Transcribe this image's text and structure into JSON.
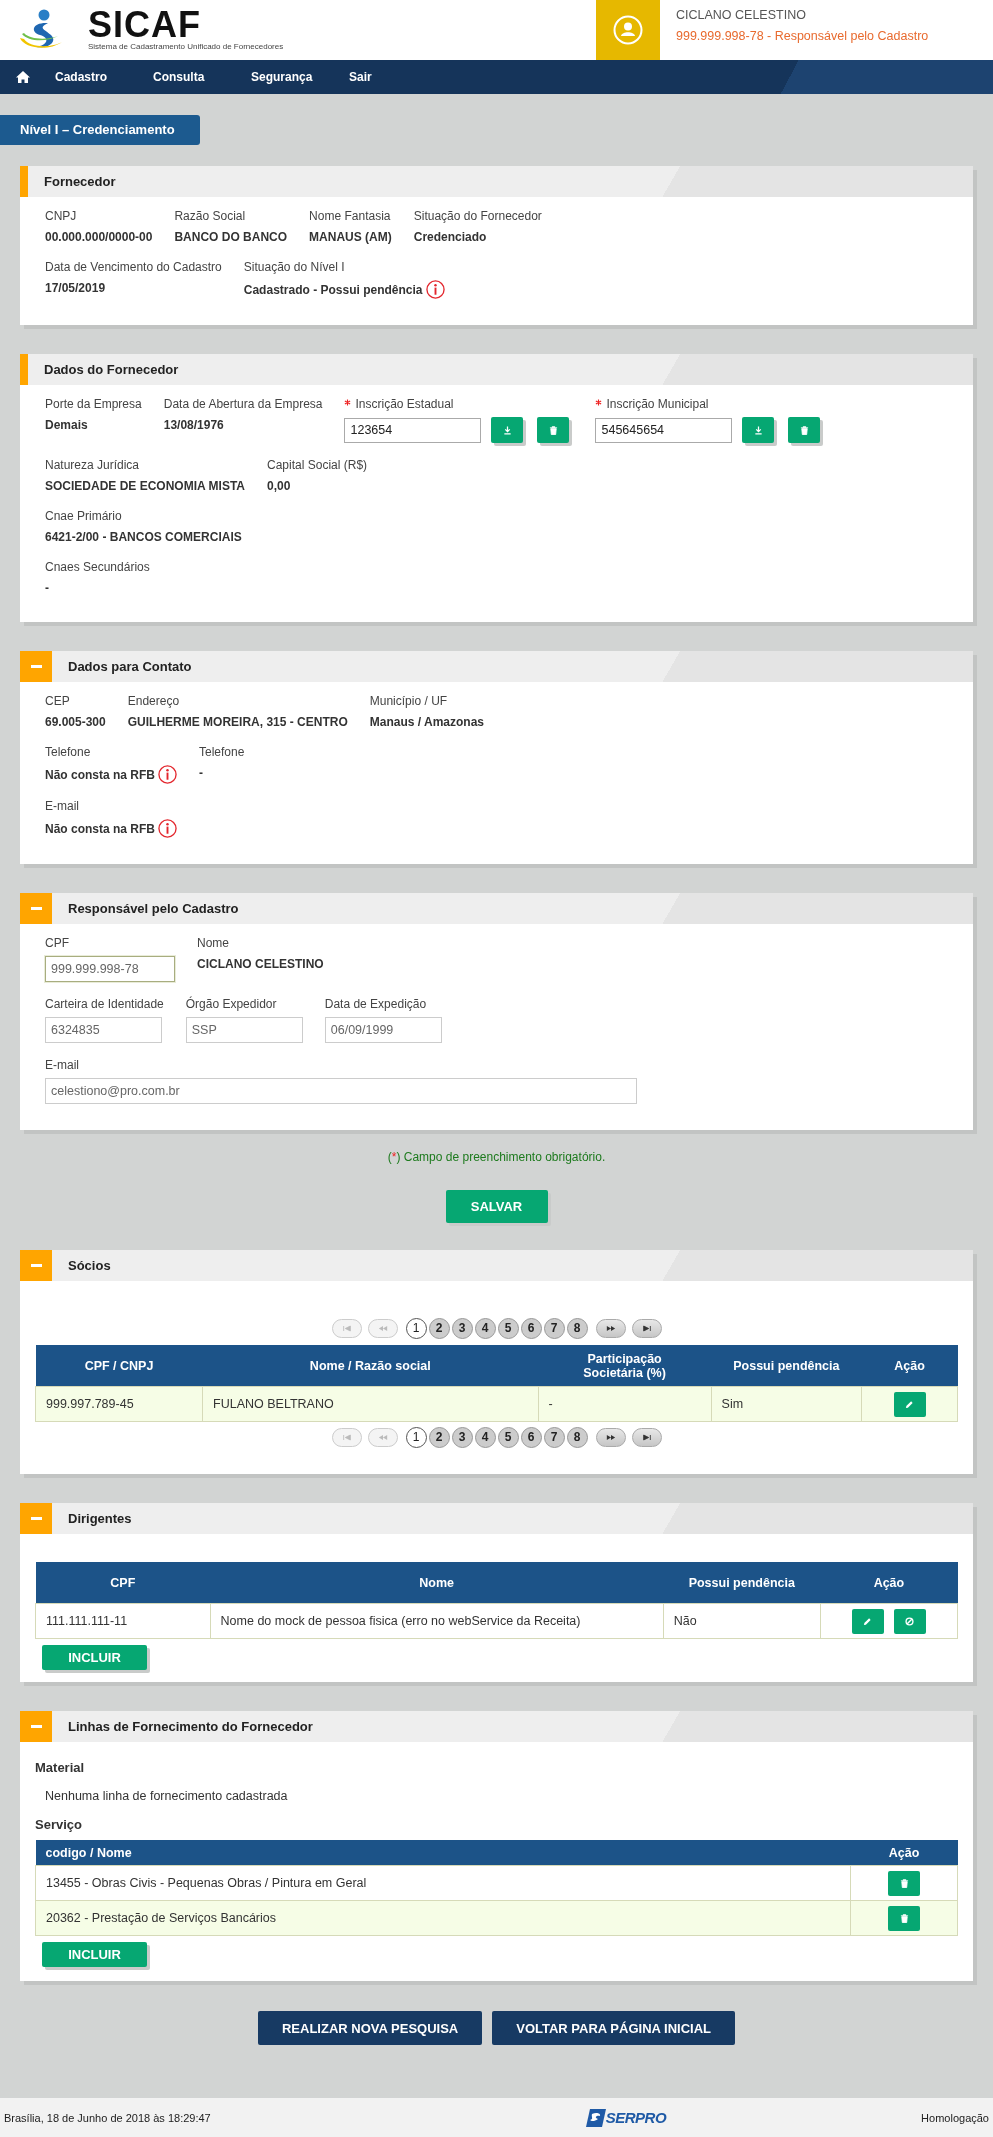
{
  "header": {
    "logo": {
      "name": "SICAF",
      "subtitle": "Sistema de Cadastramento Unificado de Fornecedores"
    },
    "user": {
      "name": "CICLANO CELESTINO",
      "details": "999.999.998-78 - Responsável pelo Cadastro"
    }
  },
  "nav": {
    "items": [
      "Cadastro",
      "Consulta",
      "Segurança",
      "Sair"
    ]
  },
  "page_badge": "Nível I – Credenciamento",
  "sections_top": [
    {
      "title": "Fornecedor",
      "collapsible": false,
      "rows": [
        [
          {
            "kind": "text",
            "label": "CNPJ",
            "value": "00.000.000/0000-00",
            "alert": false
          },
          {
            "kind": "text",
            "label": "Razão Social",
            "value": "BANCO DO BANCO",
            "alert": false
          },
          {
            "kind": "text",
            "label": "Nome Fantasia",
            "value": "MANAUS (AM)",
            "alert": false
          },
          {
            "kind": "text",
            "label": "Situação do Fornecedor",
            "value": "Credenciado",
            "alert": false
          }
        ],
        [
          {
            "kind": "text",
            "label": "Data de Vencimento do Cadastro",
            "value": "17/05/2019",
            "alert": false
          },
          {
            "kind": "text",
            "label": "Situação do Nível I",
            "value": "Cadastrado - Possui pendência",
            "alert": true
          }
        ]
      ]
    },
    {
      "title": "Dados do Fornecedor",
      "collapsible": false,
      "rows": [
        [
          {
            "kind": "text",
            "label": "Porte da Empresa",
            "value": "Demais",
            "alert": false
          },
          {
            "kind": "text",
            "label": "Data de Abertura da Empresa",
            "value": "13/08/1976",
            "alert": false
          },
          {
            "kind": "input_actions",
            "label": "Inscrição Estadual",
            "value": "123654",
            "required": true
          },
          {
            "kind": "input_actions",
            "label": "Inscrição Municipal",
            "value": "545645654",
            "required": true
          }
        ],
        [
          {
            "kind": "text",
            "label": "Natureza Jurídica",
            "value": "SOCIEDADE DE ECONOMIA MISTA",
            "alert": false
          },
          {
            "kind": "text",
            "label": "Capital Social (R$)",
            "value": "0,00",
            "alert": false
          }
        ],
        [
          {
            "kind": "text",
            "label": "Cnae Primário",
            "value": "6421-2/00 - BANCOS COMERCIAIS",
            "alert": false
          }
        ],
        [
          {
            "kind": "text",
            "label": "Cnaes Secundários",
            "value": "-",
            "alert": false
          }
        ]
      ]
    },
    {
      "title": "Dados para Contato",
      "collapsible": true,
      "rows": [
        [
          {
            "kind": "text",
            "label": "CEP",
            "value": "69.005-300",
            "alert": false
          },
          {
            "kind": "text",
            "label": "Endereço",
            "value": "GUILHERME MOREIRA, 315 - CENTRO",
            "alert": false
          },
          {
            "kind": "text",
            "label": "Município / UF",
            "value": "Manaus / Amazonas",
            "alert": false
          }
        ],
        [
          {
            "kind": "text",
            "label": "Telefone",
            "value": "Não consta na RFB",
            "alert": true
          },
          {
            "kind": "text",
            "label": "Telefone",
            "value": "-",
            "alert": false
          }
        ],
        [
          {
            "kind": "text",
            "label": "E-mail",
            "value": "Não consta na RFB",
            "alert": true
          }
        ]
      ]
    },
    {
      "title": "Responsável pelo Cadastro",
      "collapsible": true,
      "rows": [
        [
          {
            "kind": "readonly_input",
            "label": "CPF",
            "value": "999.999.998-78",
            "focused": true
          },
          {
            "kind": "text",
            "label": "Nome",
            "value": "CICLANO CELESTINO",
            "alert": false
          }
        ],
        [
          {
            "kind": "readonly_input",
            "label": "Carteira de Identidade",
            "value": "6324835",
            "focused": false
          },
          {
            "kind": "readonly_input",
            "label": "Órgão Expedidor",
            "value": "SSP",
            "focused": false
          },
          {
            "kind": "readonly_input",
            "label": "Data de Expedição",
            "value": "06/09/1999",
            "focused": false
          }
        ],
        [
          {
            "kind": "readonly_input",
            "label": "E-mail",
            "value": "celestiono@pro.com.br",
            "focused": false
          }
        ]
      ]
    }
  ],
  "required_note": {
    "open": "(",
    "mark": "*",
    "text": ") Campo de preenchimento obrigatório."
  },
  "save_button": "SALVAR",
  "sections_bottom": [
    {
      "kind": "table",
      "title": "Sócios",
      "collapsible": true,
      "pagination_top": {
        "controls_before": [
          {
            "kind": "first",
            "disabled": true
          },
          {
            "kind": "prev",
            "disabled": true
          }
        ],
        "pages": [
          {
            "label": "1",
            "selected": true
          },
          {
            "label": "2",
            "selected": false
          },
          {
            "label": "3",
            "selected": false
          },
          {
            "label": "4",
            "selected": false
          },
          {
            "label": "5",
            "selected": false
          },
          {
            "label": "6",
            "selected": false
          },
          {
            "label": "7",
            "selected": false
          },
          {
            "label": "8",
            "selected": false
          }
        ],
        "controls_after": [
          {
            "kind": "next",
            "disabled": false
          },
          {
            "kind": "last",
            "disabled": false
          }
        ]
      },
      "table": {
        "columns": [
          "CPF / CNPJ",
          "Nome / Razão social",
          "Participação Societária (%)",
          "Possui pendência",
          "Ação"
        ],
        "rows": [
          {
            "highlighted": true,
            "cells": [
              "999.997.789-45",
              "FULANO BELTRANO",
              "-",
              "Sim"
            ],
            "actions": [
              {
                "kind": "edit"
              }
            ]
          }
        ]
      },
      "pagination_bottom": {
        "controls_before": [
          {
            "kind": "first",
            "disabled": true
          },
          {
            "kind": "prev",
            "disabled": true
          }
        ],
        "pages": [
          {
            "label": "1",
            "selected": true
          },
          {
            "label": "2",
            "selected": false
          },
          {
            "label": "3",
            "selected": false
          },
          {
            "label": "4",
            "selected": false
          },
          {
            "label": "5",
            "selected": false
          },
          {
            "label": "6",
            "selected": false
          },
          {
            "label": "7",
            "selected": false
          },
          {
            "label": "8",
            "selected": false
          }
        ],
        "controls_after": [
          {
            "kind": "next",
            "disabled": false
          },
          {
            "kind": "last",
            "disabled": false
          }
        ]
      }
    },
    {
      "kind": "table",
      "title": "Dirigentes",
      "collapsible": true,
      "table": {
        "columns": [
          "CPF",
          "Nome",
          "Possui pendência",
          "Ação"
        ],
        "rows": [
          {
            "highlighted": false,
            "cells": [
              "111.111.111-11",
              "Nome do mock de pessoa fisica (erro no webService da Receita)",
              "Não"
            ],
            "actions": [
              {
                "kind": "edit"
              },
              {
                "kind": "block"
              }
            ]
          }
        ]
      },
      "add_button": "INCLUIR"
    },
    {
      "kind": "lines",
      "title": "Linhas de Fornecimento do Fornecedor",
      "collapsible": true,
      "groups": [
        {
          "heading": "Material",
          "empty_text": "Nenhuma linha de fornecimento cadastrada"
        },
        {
          "heading": "Serviço",
          "table": {
            "columns": [
              "codigo / Nome",
              "Ação"
            ],
            "rows": [
              {
                "highlighted": false,
                "cells": [
                  "13455 - Obras Civis - Pequenas Obras / Pintura em Geral"
                ],
                "actions": [
                  {
                    "kind": "delete"
                  }
                ]
              },
              {
                "highlighted": true,
                "cells": [
                  "20362 - Prestação de Serviços Bancários"
                ],
                "actions": [
                  {
                    "kind": "delete"
                  }
                ]
              }
            ]
          }
        }
      ],
      "add_button": "INCLUIR"
    }
  ],
  "bottom_buttons": [
    "REALIZAR NOVA PESQUISA",
    "VOLTAR PARA PÁGINA INICIAL"
  ],
  "footer": {
    "timestamp": "Brasília, 18 de Junho de 2018 às 18:29:47",
    "logo": "SERPRO",
    "environment": "Homologação"
  }
}
